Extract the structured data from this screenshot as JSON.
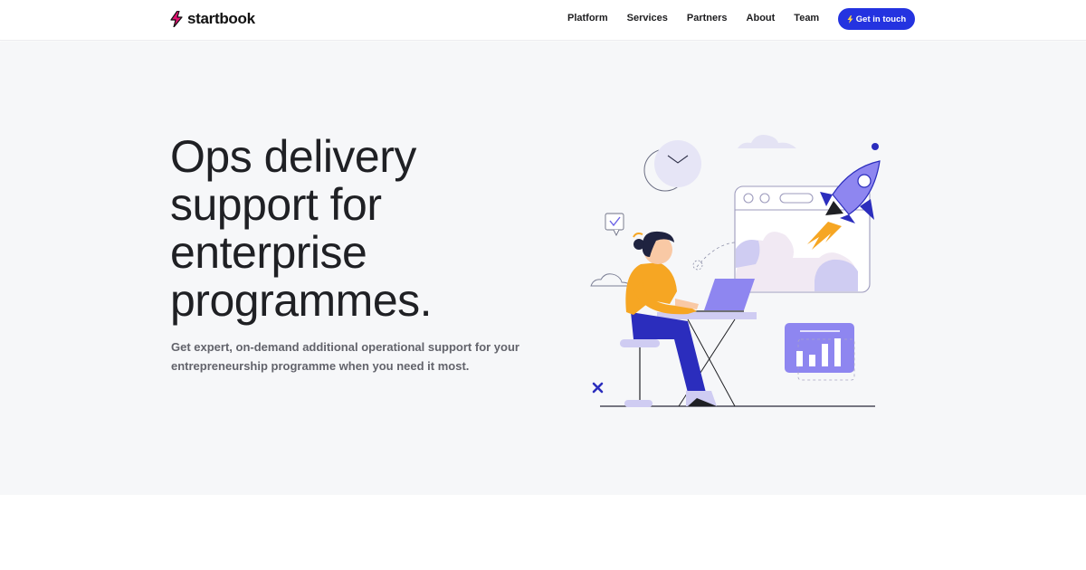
{
  "brand": {
    "name": "startbook",
    "logo_icon": "lightning-bolt-icon",
    "logo_color": "#e0116f"
  },
  "nav": {
    "links": [
      "Platform",
      "Services",
      "Partners",
      "About",
      "Team"
    ],
    "cta_label": "Get in touch",
    "cta_icon": "lightning-bolt-icon",
    "cta_color": "#2433e0"
  },
  "hero": {
    "headline_lines": [
      "Ops delivery",
      "support for",
      "enterprise",
      "programmes."
    ],
    "subtitle_lines": [
      "Get expert, on-demand additional operational support for your",
      "entrepreneurship programme when you need it most."
    ],
    "background": "#f6f7f9",
    "illustration": "woman-at-laptop-rocket-launch-illustration"
  },
  "colors": {
    "accent": "#2433e0",
    "illustration_purple": "#8e86f0",
    "illustration_orange": "#f6a623",
    "illustration_navy": "#2b2dbd"
  }
}
